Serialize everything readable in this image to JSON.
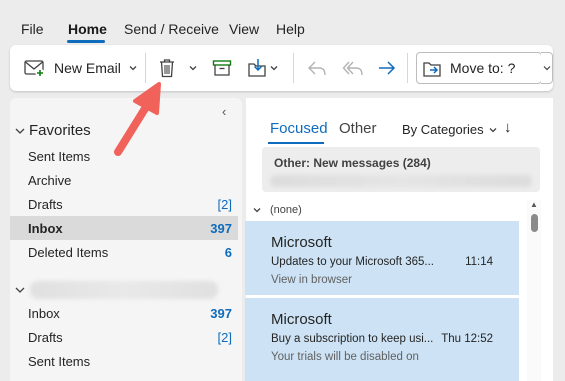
{
  "menubar": {
    "items": [
      "File",
      "Home",
      "Send / Receive",
      "View",
      "Help"
    ],
    "active": "Home"
  },
  "ribbon": {
    "new_email_label": "New Email",
    "move_to_label": "Move to: ?"
  },
  "folders": {
    "favorites_label": "Favorites",
    "favorites": [
      {
        "name": "Sent Items",
        "count": ""
      },
      {
        "name": "Archive",
        "count": ""
      },
      {
        "name": "Drafts",
        "count": "[2]"
      },
      {
        "name": "Inbox",
        "count": "397"
      },
      {
        "name": "Deleted Items",
        "count": "6"
      }
    ],
    "account": [
      {
        "name": "Inbox",
        "count": "397"
      },
      {
        "name": "Drafts",
        "count": "[2]"
      },
      {
        "name": "Sent Items",
        "count": ""
      }
    ]
  },
  "list": {
    "tabs": [
      "Focused",
      "Other"
    ],
    "active_tab": "Focused",
    "filter_label": "By Categories",
    "other_notice": "Other: New messages (284)",
    "group_label": "(none)",
    "messages": [
      {
        "sender": "Microsoft",
        "subject": "Updates to your Microsoft 365...",
        "time": "11:14",
        "preview": "View in browser"
      },
      {
        "sender": "Microsoft",
        "subject": "Buy a subscription to keep usi...",
        "time": "Thu 12:52",
        "preview": "Your trials will be disabled on"
      }
    ]
  },
  "colors": {
    "accent": "#0f6cbd",
    "selected_message": "#cde3f5",
    "callout": "#f0625a"
  }
}
